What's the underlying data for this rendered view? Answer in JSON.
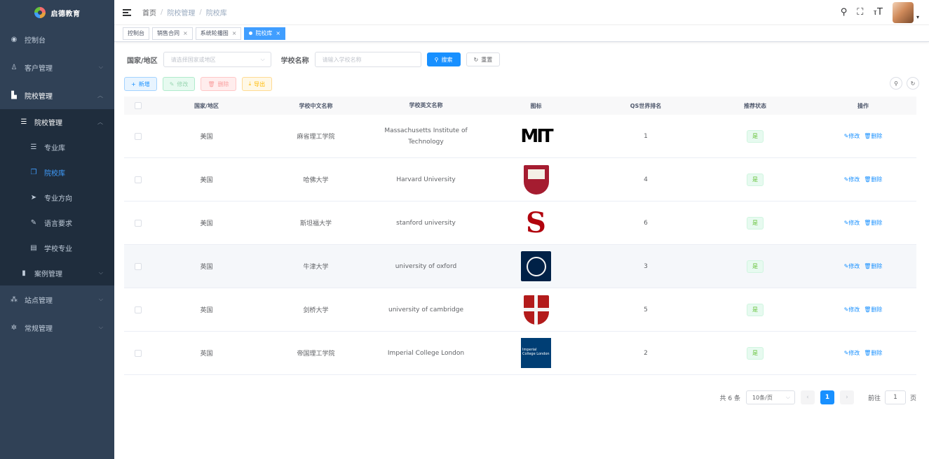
{
  "sidebar": {
    "logo_text": "启德教育",
    "items": [
      {
        "label": "控制台",
        "icon": "dashboard-icon"
      },
      {
        "label": "客户管理",
        "icon": "user-icon"
      },
      {
        "label": "院校管理",
        "icon": "building-icon"
      },
      {
        "label": "院校管理",
        "icon": "list-icon"
      },
      {
        "label": "专业库",
        "icon": "list-icon"
      },
      {
        "label": "院校库",
        "icon": "copy-icon"
      },
      {
        "label": "专业方向",
        "icon": "send-icon"
      },
      {
        "label": "语言要求",
        "icon": "edit-icon"
      },
      {
        "label": "学校专业",
        "icon": "document-icon"
      },
      {
        "label": "案例管理",
        "icon": "book-icon"
      },
      {
        "label": "站点管理",
        "icon": "sitemap-icon"
      },
      {
        "label": "常规管理",
        "icon": "gear-icon"
      }
    ]
  },
  "header": {
    "breadcrumb": [
      "首页",
      "院校管理",
      "院校库"
    ]
  },
  "tags": [
    {
      "label": "控制台",
      "closable": false
    },
    {
      "label": "销售合同",
      "closable": true
    },
    {
      "label": "系统轮播图",
      "closable": true
    },
    {
      "label": "院校库",
      "closable": true,
      "active": true
    }
  ],
  "search": {
    "country_label": "国家/地区",
    "country_placeholder": "请选择国家或地区",
    "school_label": "学校名称",
    "school_placeholder": "请输入学校名称",
    "search_btn": "搜索",
    "reset_btn": "重置"
  },
  "toolbar": {
    "add": "新增",
    "edit": "修改",
    "delete": "删除",
    "export": "导出"
  },
  "table": {
    "columns": [
      "国家/地区",
      "学校中文名称",
      "学校英文名称",
      "图标",
      "QS世界排名",
      "推荐状态",
      "操作"
    ],
    "rows": [
      {
        "country": "美国",
        "cn": "麻省理工学院",
        "en": "Massachusetts Institute of Technology",
        "logo": "mit-logo",
        "rank": "1",
        "status": "是"
      },
      {
        "country": "美国",
        "cn": "哈佛大学",
        "en": "Harvard University",
        "logo": "harvard-logo",
        "rank": "4",
        "status": "是"
      },
      {
        "country": "美国",
        "cn": "斯坦福大学",
        "en": "stanford university",
        "logo": "stanford-logo",
        "rank": "6",
        "status": "是"
      },
      {
        "country": "英国",
        "cn": "牛津大学",
        "en": "university of oxford",
        "logo": "oxford-logo",
        "rank": "3",
        "status": "是"
      },
      {
        "country": "英国",
        "cn": "剑桥大学",
        "en": "university of cambridge",
        "logo": "cambridge-logo",
        "rank": "5",
        "status": "是"
      },
      {
        "country": "英国",
        "cn": "帝国理工学院",
        "en": "Imperial College London",
        "logo": "imperial-logo",
        "rank": "2",
        "status": "是"
      }
    ],
    "op_edit": "修改",
    "op_delete": "删除"
  },
  "logos": {
    "mit": "MIT",
    "stanford": "S",
    "imperial": "Imperial College London"
  },
  "pagination": {
    "total": "共 6 条",
    "page_size": "10条/页",
    "current": "1",
    "goto_prefix": "前往",
    "goto_value": "1",
    "goto_suffix": "页"
  },
  "colors": {
    "sidebar_bg": "#304156",
    "submenu_bg": "#1f2d3d",
    "primary": "#1890ff",
    "success": "#67c23a"
  }
}
